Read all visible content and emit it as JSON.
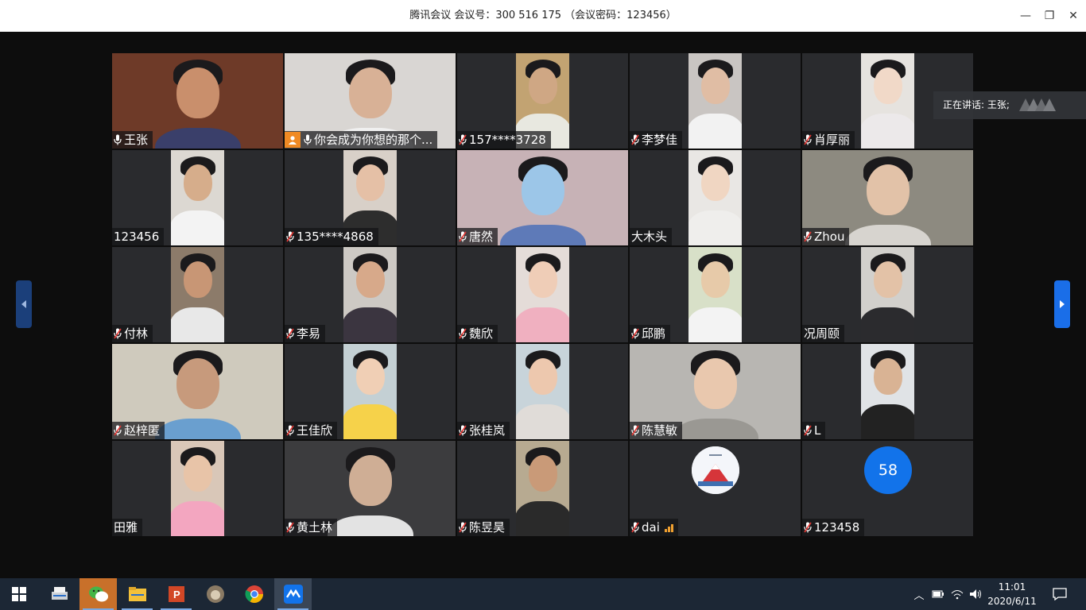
{
  "window": {
    "title": "腾讯会议  会议号：300 516 175 （会议密码：123456）",
    "minimize": "—",
    "restore": "❐",
    "close": "✕"
  },
  "speaking_banner": {
    "label": "正在讲话: 王张;"
  },
  "participants": [
    {
      "name": "王张",
      "mic": "on",
      "active": true,
      "bg": "#6e3a28",
      "face": "#c98f6c",
      "shirt": "#3a3f6a",
      "feed": "wide"
    },
    {
      "name": "你会成为你想的那个...",
      "mic": "on",
      "host": true,
      "bg": "#d9d6d3",
      "face": "#d8b196",
      "shirt": "#f0f0f0",
      "feed": "wide"
    },
    {
      "name": "157****3728",
      "mic": "off",
      "bg": "#c2a372",
      "face": "#cfa784",
      "shirt": "#e8e8e0",
      "feed": "narrow"
    },
    {
      "name": "李梦佳",
      "mic": "off",
      "bg": "#c9c5c2",
      "face": "#e0bda4",
      "shirt": "#f2f2f2",
      "feed": "narrow"
    },
    {
      "name": "肖厚丽",
      "mic": "off",
      "bg": "#e6e3df",
      "face": "#f1d9c8",
      "shirt": "#ece9ea",
      "feed": "narrow"
    },
    {
      "name": "123456",
      "mic": "none",
      "bg": "#dcd8d2",
      "face": "#d6ad8b",
      "shirt": "#f3f3f3",
      "feed": "narrow"
    },
    {
      "name": "135****4868",
      "mic": "off",
      "bg": "#d8d0c8",
      "face": "#e5c0a6",
      "shirt": "#2d2d2d",
      "feed": "narrow"
    },
    {
      "name": "唐然",
      "mic": "off",
      "bg": "#c7b2b6",
      "face": "#9cc6e8",
      "shirt": "#5e7ab8",
      "feed": "wide"
    },
    {
      "name": "大木头",
      "mic": "none",
      "bg": "#e9e7e4",
      "face": "#f0d6c2",
      "shirt": "#efeeec",
      "feed": "narrow"
    },
    {
      "name": "Zhou",
      "mic": "off",
      "bg": "#8d8a80",
      "face": "#e2c2a8",
      "shirt": "#d7d4cf",
      "feed": "wide"
    },
    {
      "name": "付林",
      "mic": "off",
      "bg": "#8c7b6a",
      "face": "#c89675",
      "shirt": "#e8e8e8",
      "feed": "narrow"
    },
    {
      "name": "李易",
      "mic": "off",
      "bg": "#cdc9c4",
      "face": "#d7a98a",
      "shirt": "#3b3540",
      "feed": "narrow"
    },
    {
      "name": "魏欣",
      "mic": "off",
      "bg": "#e4dcd8",
      "face": "#efcdb7",
      "shirt": "#f0b0c0",
      "feed": "narrow"
    },
    {
      "name": "邱鹏",
      "mic": "off",
      "bg": "#d8e0c8",
      "face": "#e7caa9",
      "shirt": "#f3f3f3",
      "feed": "narrow"
    },
    {
      "name": "况周颐",
      "mic": "none",
      "bg": "#d2d0cc",
      "face": "#e3c2a7",
      "shirt": "#2b2b2e",
      "feed": "narrow"
    },
    {
      "name": "赵梓匿",
      "mic": "off",
      "bg": "#cfcabd",
      "face": "#c79a7c",
      "shirt": "#6a9fcf",
      "feed": "wide"
    },
    {
      "name": "王佳欣",
      "mic": "off",
      "bg": "#c4d0d4",
      "face": "#f0cfb5",
      "shirt": "#f6d24a",
      "feed": "narrow"
    },
    {
      "name": "张桂岚",
      "mic": "off",
      "bg": "#c8d4da",
      "face": "#edc8ae",
      "shirt": "#e0dcd8",
      "feed": "narrow"
    },
    {
      "name": "陈慧敏",
      "mic": "off",
      "bg": "#b8b6b2",
      "face": "#e9c8ae",
      "shirt": "#9a9893",
      "feed": "wide"
    },
    {
      "name": "L",
      "mic": "off",
      "bg": "#e0e3e6",
      "face": "#d9b394",
      "shirt": "#222222",
      "feed": "narrow"
    },
    {
      "name": "田雅",
      "mic": "none",
      "bg": "#d9c7b8",
      "face": "#e8c4a8",
      "shirt": "#f3a6c0",
      "feed": "narrow"
    },
    {
      "name": "黄土林",
      "mic": "off",
      "bg": "#3c3c3e",
      "face": "#cfae95",
      "shirt": "#e3e3e3",
      "feed": "wide"
    },
    {
      "name": "陈昱昊",
      "mic": "off",
      "bg": "#b7aa91",
      "face": "#c99a78",
      "shirt": "#2a2a2a",
      "feed": "narrow"
    },
    {
      "name": "dai",
      "mic": "off",
      "signal": true,
      "avatar": "logo"
    },
    {
      "name": "123458",
      "mic": "off",
      "avatar": "number",
      "avatar_text": "58"
    }
  ],
  "taskbar": {
    "apps": [
      "start-icon",
      "scanner-icon",
      "wechat-icon",
      "explorer-icon",
      "powerpoint-icon",
      "photos-icon",
      "chrome-icon",
      "tencent-meeting-icon"
    ],
    "time": "11:01",
    "date": "2020/6/11",
    "tray_up": "︿"
  },
  "colors": {
    "accent_blue": "#1273ea",
    "active_outline": "#3ecf5d",
    "host_orange": "#f08a24",
    "mic_off_red": "#e53935"
  }
}
